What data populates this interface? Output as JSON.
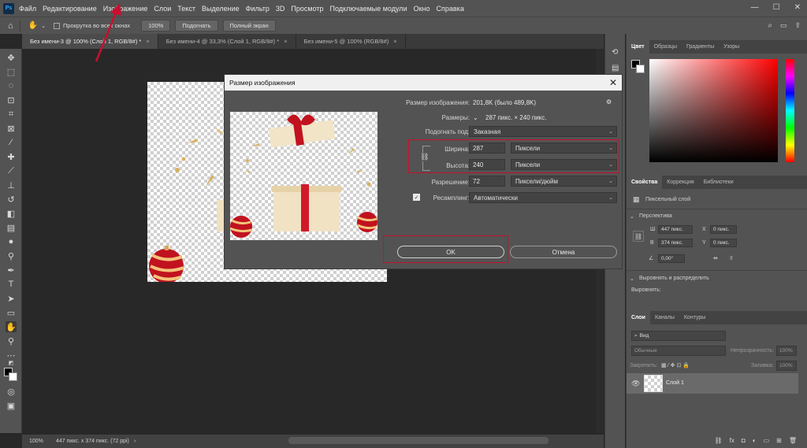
{
  "menubar": {
    "logo": "Ps",
    "items": [
      "Файл",
      "Редактирование",
      "Изображение",
      "Слои",
      "Текст",
      "Выделение",
      "Фильтр",
      "3D",
      "Просмотр",
      "Подключаемые модули",
      "Окно",
      "Справка"
    ]
  },
  "options": {
    "scroll_all": "Прокрутка во всех окнах",
    "zoom": "100%",
    "fit": "Подогнать",
    "fullscreen": "Полный экран"
  },
  "tabs": [
    {
      "label": "Без имени-3 @ 100% (Слой 1, RGB/8#) *",
      "close": "×"
    },
    {
      "label": "Без имени-4 @ 33,3% (Слой 1, RGB/8#) *",
      "close": "×"
    },
    {
      "label": "Без имени-5 @ 100% (RGB/8#)",
      "close": "×"
    }
  ],
  "status": {
    "zoom": "100%",
    "info": "447 пикс. x 374 пикс. (72 ppi)"
  },
  "right_panel": {
    "color_tabs": [
      "Цвет",
      "Образцы",
      "Градиенты",
      "Узоры"
    ],
    "props_tabs": [
      "Свойства",
      "Коррекция",
      "Библиотеки"
    ],
    "pixel_layer": "Пиксельный слой",
    "perspective": "Перспектива",
    "w_label": "Ш",
    "w_value": "447 пикс.",
    "h_label": "В",
    "h_value": "374 пикс.",
    "x_label": "X",
    "x_value": "0 пикс.",
    "y_label": "Y",
    "y_value": "0 пикс.",
    "angle": "0,00°",
    "align_section": "Выровнять и распределить",
    "align_label": "Выровнять:",
    "layers_tabs": [
      "Слои",
      "Каналы",
      "Контуры"
    ],
    "search": "Вид",
    "blend_mode": "Обычные",
    "opacity_label": "Непрозрачность:",
    "opacity": "100%",
    "lock_label": "Закрепить:",
    "fill_label": "Заливка:",
    "fill": "100%",
    "layer_name": "Слой 1"
  },
  "dialog": {
    "title": "Размер изображения",
    "close": "✕",
    "size_label": "Размер изображения:",
    "size_value": "201,8K (было 489,8K)",
    "dims_label": "Размеры:",
    "dims_value": "287 пикс.  ×  240 пикс.",
    "fit_label": "Подогнать под:",
    "fit_value": "Заказная",
    "width_label": "Ширина:",
    "width_value": "287",
    "width_unit": "Пиксели",
    "height_label": "Высота:",
    "height_value": "240",
    "height_unit": "Пиксели",
    "res_label": "Разрешение:",
    "res_value": "72",
    "res_unit": "Пиксели/дюйм",
    "resample_label": "Ресамплинг:",
    "resample_value": "Автоматически",
    "ok": "OK",
    "cancel": "Отмена"
  },
  "colors": {
    "accent_red": "#c8102e",
    "panel": "#535353",
    "canvas_bg": "#282828"
  }
}
